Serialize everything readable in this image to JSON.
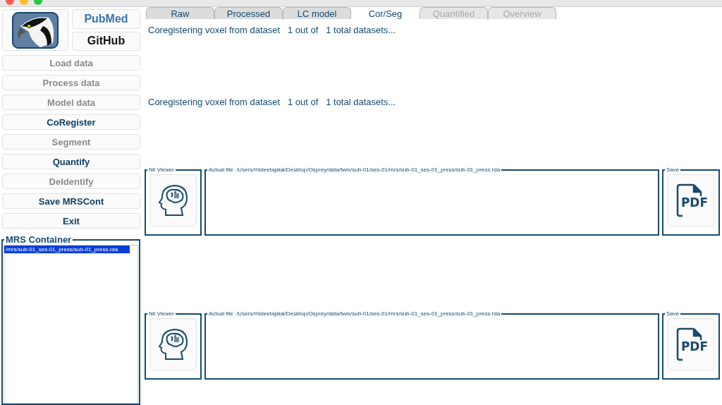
{
  "sidebar": {
    "links": [
      {
        "kind": "pubmed",
        "label": "PubMed"
      },
      {
        "kind": "github",
        "label": "GitHub"
      }
    ],
    "buttons": [
      {
        "label": "Load data",
        "disabled": true
      },
      {
        "label": "Process data",
        "disabled": true
      },
      {
        "label": "Model data",
        "disabled": true
      },
      {
        "label": "CoRegister",
        "disabled": false
      },
      {
        "label": "Segment",
        "disabled": true
      },
      {
        "label": "Quantify",
        "disabled": false
      },
      {
        "label": "DeIdentify",
        "disabled": true
      },
      {
        "label": "Save MRSCont",
        "disabled": false
      },
      {
        "label": "Exit",
        "disabled": false
      }
    ],
    "container": {
      "title": "MRS Container",
      "items": [
        {
          "label": "/mrs/sub-01_ses-01_press/sub-01_press.rda",
          "selected": true
        }
      ]
    }
  },
  "tabs": [
    {
      "label": "Raw",
      "selected": false,
      "disabled": false
    },
    {
      "label": "Processed",
      "selected": false,
      "disabled": false
    },
    {
      "label": "LC model",
      "selected": false,
      "disabled": false
    },
    {
      "label": "Cor/Seg",
      "selected": true,
      "disabled": false
    },
    {
      "label": "Quantified",
      "selected": false,
      "disabled": true
    },
    {
      "label": "Overview",
      "selected": false,
      "disabled": true
    }
  ],
  "status_lines": [
    "Coregistering voxel from dataset   1 out of   1 total datasets...",
    "Coregistering voxel from dataset   1 out of   1 total datasets..."
  ],
  "panels": [
    {
      "viewer_title": "Nii Viewer",
      "file_title": "Actual file: /Users/rhideetajalal/Desktop/Osprey/data/twix/sub-01/ses-01/mrs/sub-01_ses-01_press/sub-01_press.rda",
      "save_title": "Save",
      "save_label": "PDF"
    },
    {
      "viewer_title": "Nii Viewer",
      "file_title": "Actual file: /Users/rhideetajalal/Desktop/Osprey/data/twix/sub-01/ses-01/mrs/sub-01_ses-01_press/sub-01_press.rda",
      "save_title": "Save",
      "save_label": "PDF"
    }
  ]
}
